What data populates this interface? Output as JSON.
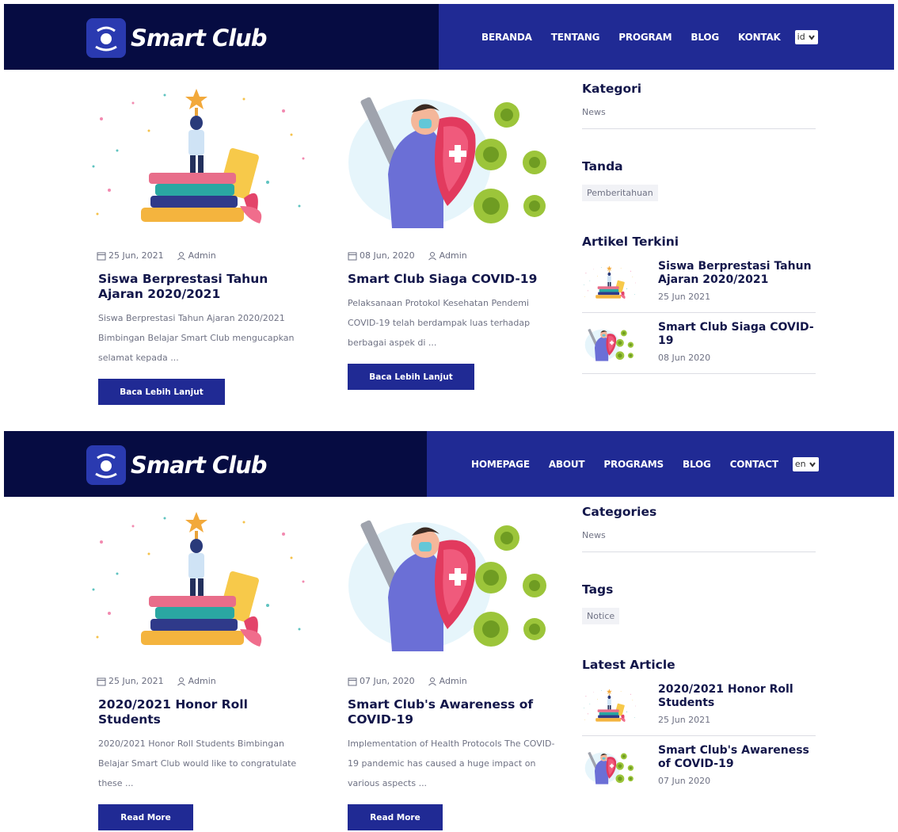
{
  "brand": {
    "name": "Smart Club"
  },
  "versions": [
    {
      "nav": {
        "items": [
          "BERANDA",
          "TENTANG",
          "PROGRAM",
          "BLOG",
          "KONTAK"
        ],
        "lang": "id"
      },
      "posts": [
        {
          "date": "25 Jun, 2021",
          "author": "Admin",
          "title": "Siswa Berprestasi Tahun Ajaran 2020/2021",
          "excerpt": "Siswa Berprestasi Tahun Ajaran 2020/2021 Bimbingan Belajar Smart Club mengucapkan selamat kepada ...",
          "button": "Baca Lebih Lanjut"
        },
        {
          "date": "08 Jun, 2020",
          "author": "Admin",
          "title": "Smart Club Siaga COVID-19",
          "excerpt": "Pelaksanaan Protokol Kesehatan Pendemi COVID-19 telah berdampak luas terhadap berbagai aspek di ...",
          "button": "Baca Lebih Lanjut"
        }
      ],
      "sidebar": {
        "categories_heading": "Kategori",
        "category": "News",
        "tags_heading": "Tanda",
        "tag": "Pemberitahuan",
        "latest_heading": "Artikel Terkini",
        "latest": [
          {
            "title": "Siswa Berprestasi Tahun Ajaran 2020/2021",
            "date": "25 Jun 2021"
          },
          {
            "title": "Smart Club Siaga COVID-19",
            "date": "08 Jun 2020"
          }
        ]
      }
    },
    {
      "nav": {
        "items": [
          "HOMEPAGE",
          "ABOUT",
          "PROGRAMS",
          "BLOG",
          "CONTACT"
        ],
        "lang": "en"
      },
      "posts": [
        {
          "date": "25 Jun, 2021",
          "author": "Admin",
          "title": "2020/2021 Honor Roll Students",
          "excerpt": "2020/2021 Honor Roll Students Bimbingan Belajar Smart Club would like to congratulate these ...",
          "button": "Read More"
        },
        {
          "date": "07 Jun, 2020",
          "author": "Admin",
          "title": "Smart Club's Awareness of COVID-19",
          "excerpt": "Implementation of Health Protocols The COVID-19 pandemic has caused a huge impact on various aspects ...",
          "button": "Read More"
        }
      ],
      "sidebar": {
        "categories_heading": "Categories",
        "category": "News",
        "tags_heading": "Tags",
        "tag": "Notice",
        "latest_heading": "Latest Article",
        "latest": [
          {
            "title": "2020/2021 Honor Roll Students",
            "date": "25 Jun 2021"
          },
          {
            "title": "Smart Club's Awareness of COVID-19",
            "date": "07 Jun 2020"
          }
        ]
      }
    }
  ],
  "colors": {
    "nav_dark": "#060c42",
    "nav_blue": "#202a94",
    "title": "#12164a",
    "text_muted": "#6f7284"
  },
  "icons": [
    "calendar-icon",
    "user-icon",
    "chevron-down-icon",
    "smart-club-logo"
  ]
}
